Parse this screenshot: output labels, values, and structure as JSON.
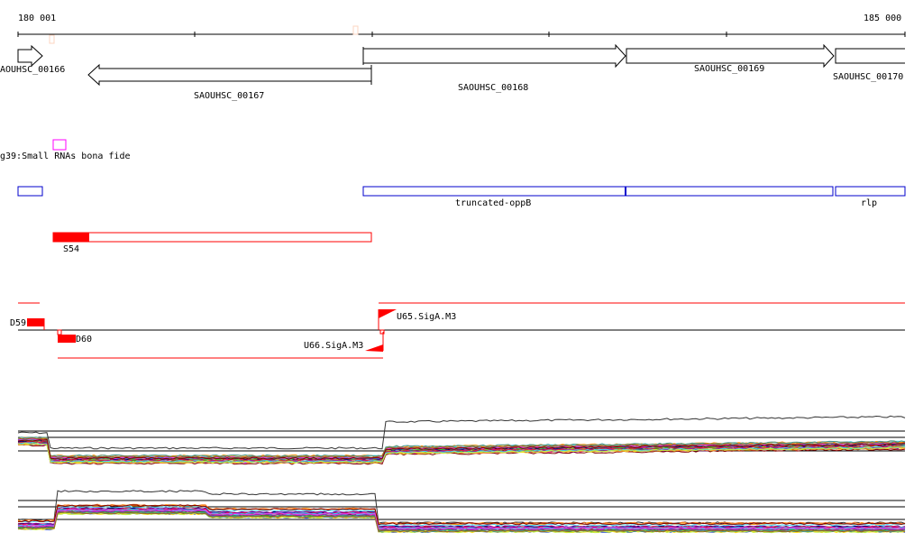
{
  "ruler": {
    "start": "180 001",
    "end": "185 000"
  },
  "genes": [
    "AOUHSC_00166",
    "SAOUHSC_00167",
    "SAOUHSC_00168",
    "SAOUHSC_00169",
    "SAOUHSC_00170"
  ],
  "srna": {
    "label": "g39:Small RNAs bona fide"
  },
  "operons": [
    "truncated-oppB",
    "rlp"
  ],
  "segment": {
    "label": "S54"
  },
  "promoters": [
    "D59",
    "D60",
    "U65.SigA.M3",
    "U66.SigA.M3"
  ],
  "colors": {
    "red": "#ff0000",
    "blue": "#0000cc",
    "magenta": "#ff00ff"
  }
}
